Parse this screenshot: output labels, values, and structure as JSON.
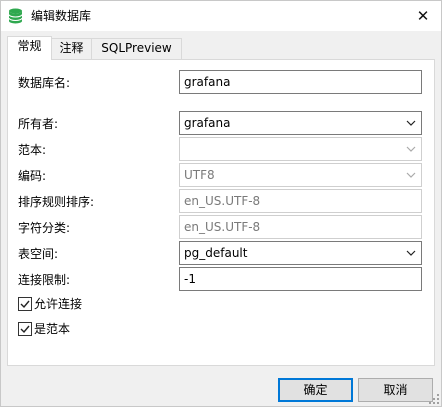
{
  "window": {
    "title": "编辑数据库",
    "close_glyph": "✕"
  },
  "tabs": [
    {
      "label": "常规"
    },
    {
      "label": "注释"
    },
    {
      "label": "SQLPreview"
    }
  ],
  "form": {
    "db_name": {
      "label": "数据库名:",
      "value": "grafana"
    },
    "owner": {
      "label": "所有者:",
      "value": "grafana"
    },
    "template": {
      "label": "范本:",
      "value": ""
    },
    "encoding": {
      "label": "编码:",
      "value": "UTF8"
    },
    "collation": {
      "label": "排序规则排序:",
      "value": "en_US.UTF-8"
    },
    "ctype": {
      "label": "字符分类:",
      "value": "en_US.UTF-8"
    },
    "tablespace": {
      "label": "表空间:",
      "value": "pg_default"
    },
    "conn_limit": {
      "label": "连接限制:",
      "value": "-1"
    },
    "allow_conn": {
      "label": "允许连接",
      "checked": true
    },
    "is_template": {
      "label": "是范本",
      "checked": true
    }
  },
  "buttons": {
    "ok": "确定",
    "cancel": "取消"
  },
  "colors": {
    "app_icon": "#2fa84f",
    "default_button_border": "#0078d7"
  },
  "icons": {
    "app": "database-icon",
    "close": "close-icon",
    "dropdown": "chevron-down-icon",
    "check": "check-icon"
  }
}
